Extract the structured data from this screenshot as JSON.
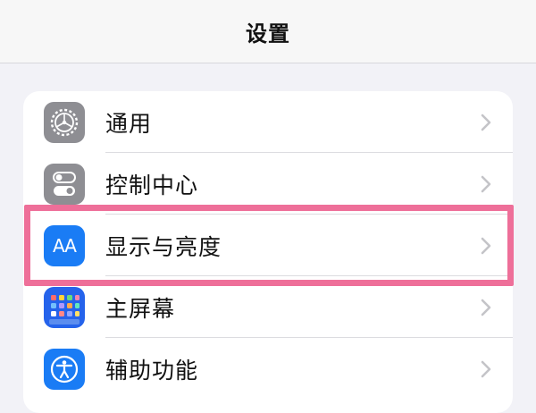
{
  "header": {
    "title": "设置"
  },
  "settings": {
    "items": [
      {
        "label": "通用",
        "icon": "gear-icon",
        "icon_bg": "#8e8e93"
      },
      {
        "label": "控制中心",
        "icon": "toggles-icon",
        "icon_bg": "#8e8e93"
      },
      {
        "label": "显示与亮度",
        "icon": "text-size-icon",
        "icon_bg": "#1a7cf5",
        "icon_text": "AA"
      },
      {
        "label": "主屏幕",
        "icon": "home-screen-icon",
        "icon_bg": "#2563eb"
      },
      {
        "label": "辅助功能",
        "icon": "accessibility-icon",
        "icon_bg": "#1a7cf5"
      }
    ]
  },
  "colors": {
    "highlight": "#ee6f99",
    "background": "#f2f2f7",
    "chevron": "#c4c4c8"
  }
}
